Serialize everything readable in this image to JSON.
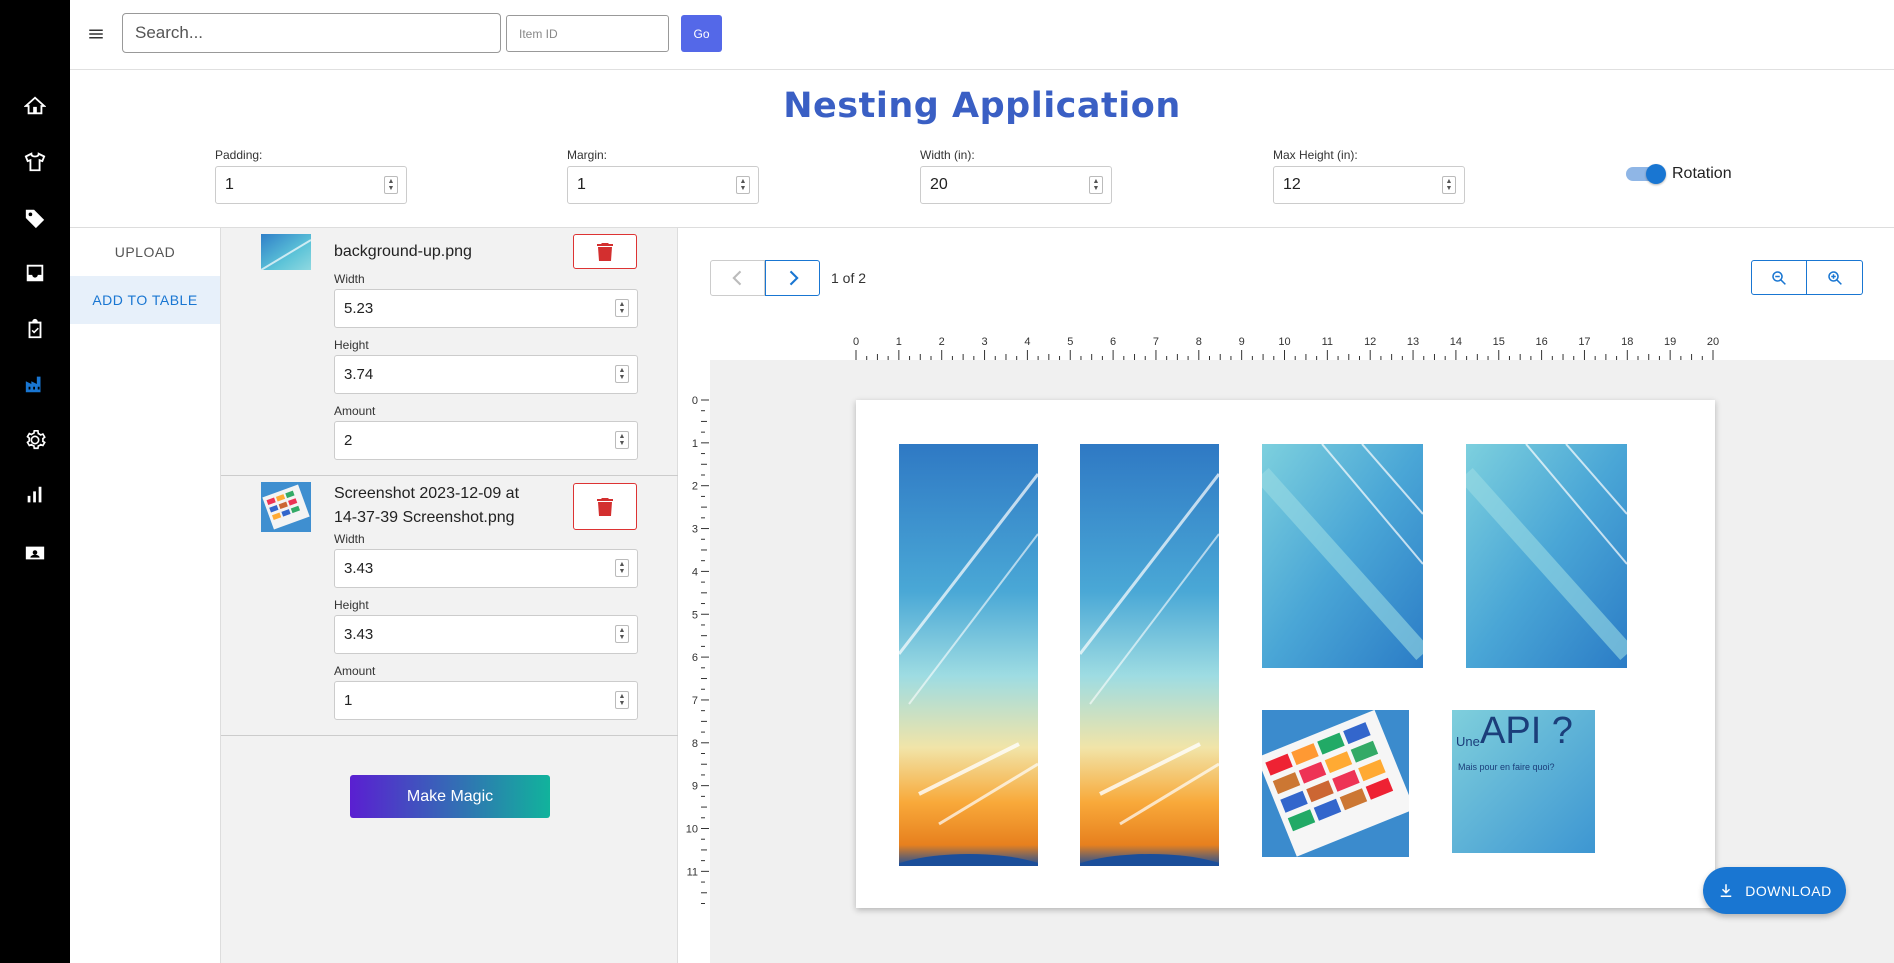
{
  "topbar": {
    "search_placeholder": "Search...",
    "item_id_placeholder": "Item ID",
    "go_label": "Go"
  },
  "sidebar": {
    "icons": [
      "home-icon",
      "tshirt-icon",
      "tag-icon",
      "inbox-icon",
      "checklist-icon",
      "factory-icon",
      "gear-icon",
      "bar-chart-icon",
      "id-card-icon"
    ],
    "active_icon": "factory-icon"
  },
  "page": {
    "title": "Nesting Application"
  },
  "settings": {
    "padding": {
      "label": "Padding:",
      "value": "1"
    },
    "margin": {
      "label": "Margin:",
      "value": "1"
    },
    "width": {
      "label": "Width (in):",
      "value": "20"
    },
    "max_height": {
      "label": "Max Height (in):",
      "value": "12"
    },
    "rotation": {
      "label": "Rotation",
      "enabled": true
    }
  },
  "tabs": [
    {
      "label": "UPLOAD",
      "active": false
    },
    {
      "label": "ADD TO TABLE",
      "active": true
    }
  ],
  "items": [
    {
      "name": "background-up.png",
      "width_label": "Width",
      "width": "5.23",
      "height_label": "Height",
      "height": "3.74",
      "amount_label": "Amount",
      "amount": "2"
    },
    {
      "name": "Screenshot 2023-12-09 at 14-37-39 Screenshot.png",
      "width_label": "Width",
      "width": "3.43",
      "height_label": "Height",
      "height": "3.43",
      "amount_label": "Amount",
      "amount": "1"
    }
  ],
  "actions": {
    "make_magic": "Make Magic",
    "download": "DOWNLOAD"
  },
  "preview": {
    "page_info": "1 of 2",
    "ruler_x": [
      "0",
      "1",
      "2",
      "3",
      "4",
      "5",
      "6",
      "7",
      "8",
      "9",
      "10",
      "11",
      "12",
      "13",
      "14",
      "15",
      "16",
      "17",
      "18",
      "19",
      "20"
    ],
    "ruler_y": [
      "0",
      "1",
      "2",
      "3",
      "4",
      "5",
      "6",
      "7",
      "8",
      "9",
      "10",
      "11"
    ],
    "api_tile_text": "API ?",
    "api_tile_small": "Une",
    "api_tile_sub": "Mais pour en faire quoi?"
  },
  "colors": {
    "accent": "#1976d2",
    "title": "#3a5fc4",
    "go": "#5468e8",
    "delete": "#d32f2f"
  }
}
